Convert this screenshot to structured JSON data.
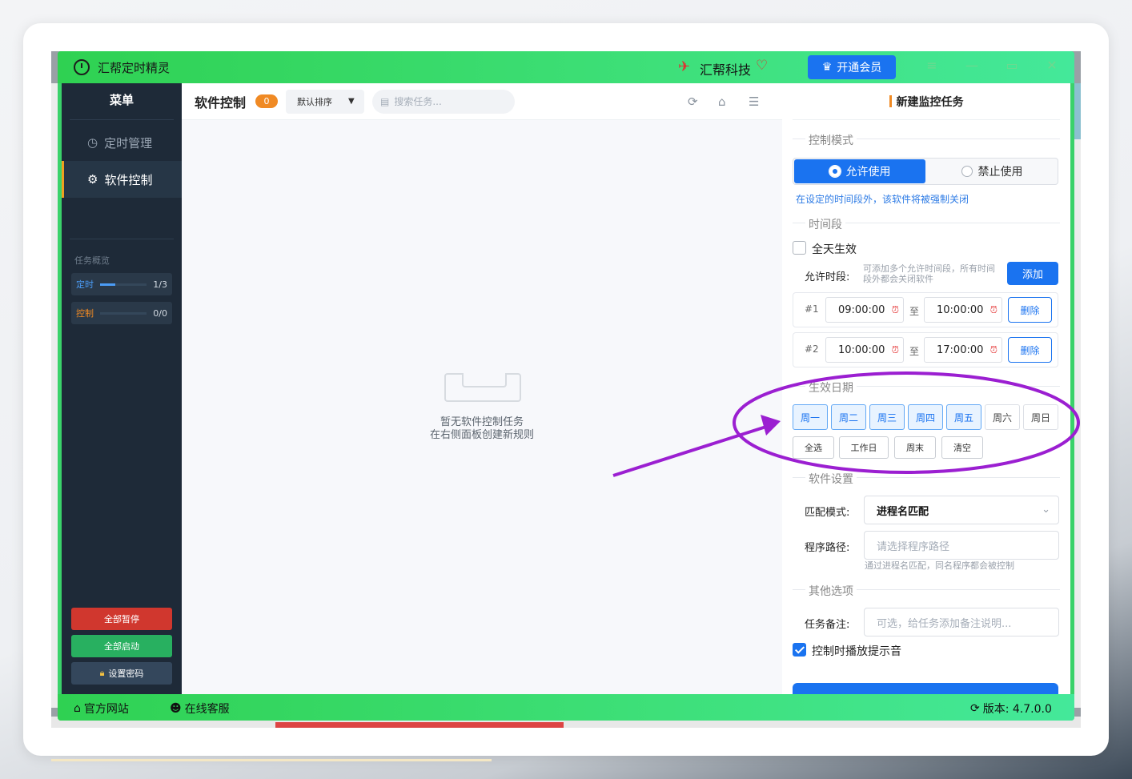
{
  "app": {
    "title": "汇帮定时精灵",
    "brand": "汇帮科技",
    "vip_label": "开通会员"
  },
  "sidebar": {
    "header": "菜单",
    "items": [
      {
        "label": "定时管理",
        "icon": "clock-icon"
      },
      {
        "label": "软件控制",
        "icon": "gear-icon",
        "active": true
      }
    ],
    "overview_title": "任务概览",
    "overview": [
      {
        "label": "定时",
        "value": "1/3",
        "progress": 0.33,
        "color": "#4b9cf5"
      },
      {
        "label": "控制",
        "value": "0/0",
        "progress": 0,
        "color": "#f08a24"
      }
    ],
    "buttons": {
      "pause_all": "全部暂停",
      "start_all": "全部启动",
      "set_password": "设置密码"
    }
  },
  "main": {
    "title": "软件控制",
    "count": "0",
    "sort_label": "默认排序",
    "search_placeholder": "搜索任务...",
    "empty_line1": "暂无软件控制任务",
    "empty_line2": "在右侧面板创建新规则"
  },
  "panel": {
    "title": "新建监控任务",
    "sections": {
      "mode": "控制模式",
      "time": "时间段",
      "date": "生效日期",
      "software": "软件设置",
      "other": "其他选项"
    },
    "mode_allow": "允许使用",
    "mode_deny": "禁止使用",
    "mode_hint": "在设定的时间段外，该软件将被强制关闭",
    "all_day": "全天生效",
    "allowed_period_label": "允许时段:",
    "allowed_period_hint_1": "可添加多个允许时间段，所有时间",
    "allowed_period_hint_2": "段外都会关闭软件",
    "add_label": "添加",
    "slots": [
      {
        "num": "#1",
        "start": "09:00:00",
        "end": "10:00:00"
      },
      {
        "num": "#2",
        "start": "10:00:00",
        "end": "17:00:00"
      }
    ],
    "to_label": "至",
    "delete_label": "删除",
    "days": [
      {
        "label": "周一",
        "selected": true
      },
      {
        "label": "周二",
        "selected": true
      },
      {
        "label": "周三",
        "selected": true
      },
      {
        "label": "周四",
        "selected": true
      },
      {
        "label": "周五",
        "selected": true
      },
      {
        "label": "周六",
        "selected": false
      },
      {
        "label": "周日",
        "selected": false
      }
    ],
    "quick": {
      "all": "全选",
      "workday": "工作日",
      "weekend": "周末",
      "clear": "清空"
    },
    "match_label": "匹配模式:",
    "match_value": "进程名匹配",
    "path_label": "程序路径:",
    "path_placeholder": "请选择程序路径",
    "path_hint": "通过进程名匹配，同名程序都会被控制",
    "note_label": "任务备注:",
    "note_placeholder": "可选，给任务添加备注说明...",
    "sound_label": "控制时播放提示音",
    "sound_checked": true
  },
  "statusbar": {
    "website": "官方网站",
    "service": "在线客服",
    "version": "版本: 4.7.0.0"
  },
  "colors": {
    "titlebar": "#3ad26a",
    "accent": "#1a73f0",
    "annotation": "#9b1fd1"
  }
}
